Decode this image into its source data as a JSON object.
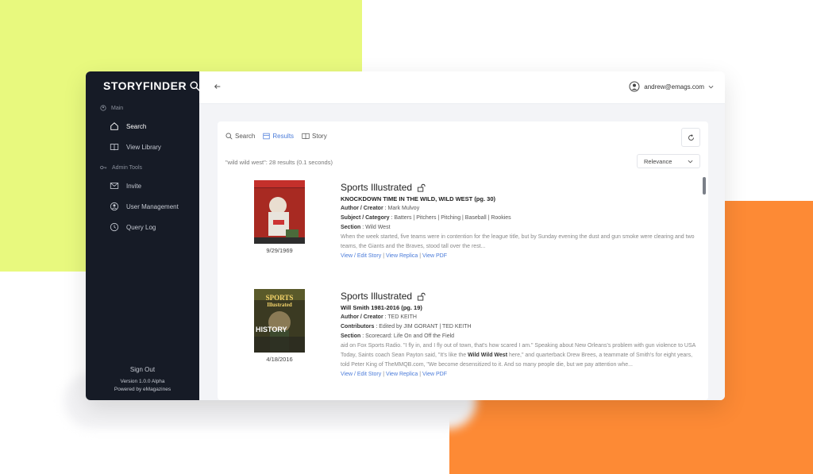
{
  "app": {
    "name": "STORYFINDER",
    "version": "Version 1.0.0 Alpha",
    "powered_by": "Powered by eMagazines",
    "sign_out": "Sign Out"
  },
  "sidebar": {
    "sections": [
      {
        "label": "Main",
        "items": [
          {
            "label": "Search",
            "icon": "home-icon",
            "active": true
          },
          {
            "label": "View Library",
            "icon": "book-icon"
          }
        ]
      },
      {
        "label": "Admin Tools",
        "items": [
          {
            "label": "Invite",
            "icon": "mail-icon"
          },
          {
            "label": "User Management",
            "icon": "user-circle-icon"
          },
          {
            "label": "Query Log",
            "icon": "clock-icon"
          }
        ]
      }
    ]
  },
  "header": {
    "back_icon": "arrow-left-icon",
    "user_email": "andrew@emags.com"
  },
  "toolbar": {
    "tabs": [
      {
        "label": "Search",
        "icon": "search-icon"
      },
      {
        "label": "Results",
        "icon": "list-icon",
        "active": true
      },
      {
        "label": "Story",
        "icon": "book-icon"
      }
    ],
    "refresh_icon": "refresh-icon"
  },
  "results_summary": "\"wild wild west\": 28 results (0.1 seconds)",
  "sort": {
    "selected": "Relevance"
  },
  "results": [
    {
      "date": "9/29/1969",
      "publication": "Sports Illustrated",
      "headline": "KNOCKDOWN TIME IN THE WILD, WILD WEST (pg. 30)",
      "fields": [
        {
          "label": "Author / Creator",
          "value": "Mark Mulvoy"
        },
        {
          "label": "Subject / Category",
          "value": "Batters | Pitchers | Pitching | Baseball | Rookies"
        },
        {
          "label": "Section",
          "value": "Wild West"
        }
      ],
      "snippet": "When the week started, five teams were in contention for the league title, but by Sunday evening the dust and gun smoke were clearing and two teams, the Giants and the Braves, stood tall over the rest...",
      "links": [
        "View / Edit Story",
        "View Replica",
        "View PDF"
      ]
    },
    {
      "date": "4/18/2016",
      "publication": "Sports Illustrated",
      "headline": "Will Smith 1981-2016 (pg. 19)",
      "fields": [
        {
          "label": "Author / Creator",
          "value": "TED KEITH"
        },
        {
          "label": "Contributors",
          "value": "Edited by JIM GORANT | TED KEITH"
        },
        {
          "label": "Section",
          "value": "Scorecard: Life On and Off the Field"
        }
      ],
      "snippet_pre": "aid on Fox Sports Radio. \"I fly in, and I fly out of town, that's how scared I am.\" Speaking about New Orleans's problem with gun violence to USA Today, Saints coach Sean Payton said, \"It's like the ",
      "snippet_bold": "Wild Wild West",
      "snippet_post": " here,\" and quarterback Drew Brees, a teammate of Smith's for eight years, told Peter King of TheMMQB.com, \"We become desensitized to it. And so many people die, but we pay attention whe...",
      "links": [
        "View / Edit Story",
        "View Replica",
        "View PDF"
      ],
      "cover_text": {
        "top": "SPORTS",
        "mid": "Illustrated",
        "bottom": "HISTORY"
      }
    }
  ]
}
